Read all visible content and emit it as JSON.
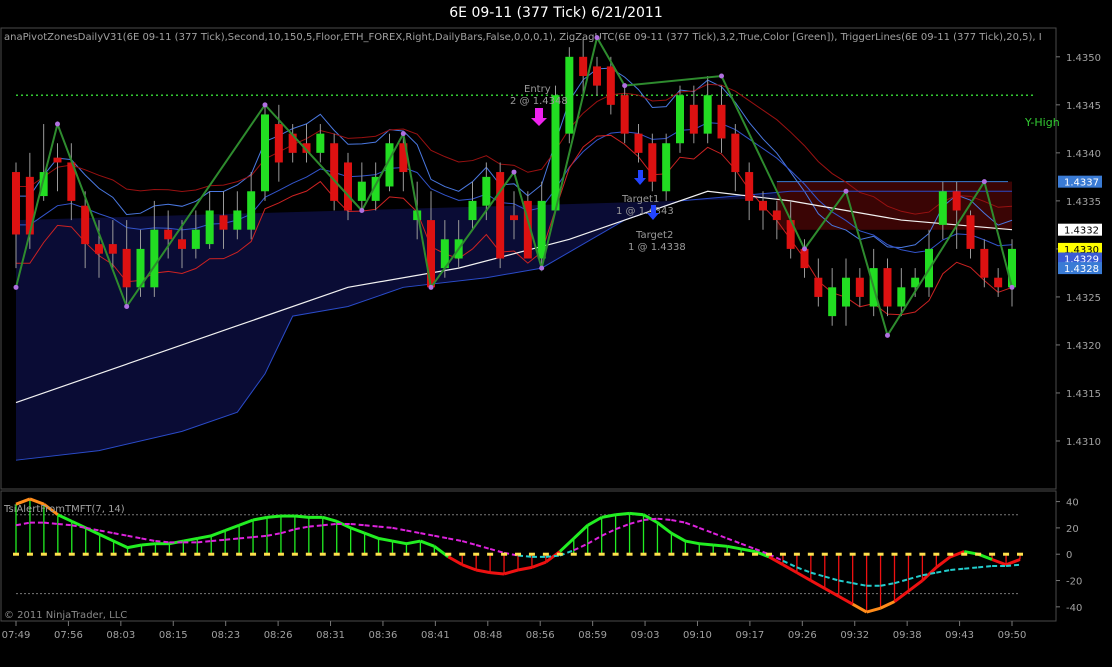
{
  "title": "6E 09-11 (377 Tick)  6/21/2011",
  "indicators_text": "anaPivotZonesDailyV31(6E 09-11 (377 Tick),Second,10,150,5,Floor,ETH_FOREX,Right,DailyBars,False,0,0,0,1), ZigZagUTC(6E 09-11 (377 Tick),3,2,True,Color [Green]), TriggerLines(6E 09-11 (377 Tick),20,5), I",
  "copyright": "© 2011 NinjaTrader, LLC",
  "colors": {
    "up_candle": "#22dd22",
    "down_candle": "#dd1111",
    "zigzag": "#2e8b2e",
    "pivot_dot": "#b070e0",
    "yhigh_line": "#33cc33",
    "upper_zone_fill": "#3a0505",
    "lower_zone_fill": "#0a0c35",
    "price_label_current": "#ffff00",
    "trigger_up": "#22ee22",
    "trigger_down": "#ee1111",
    "trigger_signal": "#dd22dd",
    "trigger_signal_2": "#22cccc"
  },
  "annotations": {
    "y_high": "Y-High",
    "entry": "Entry",
    "entry_detail": "2 @ 1.4348",
    "target1": "Target1",
    "target1_detail": "1 @ 1.4343",
    "target2": "Target2",
    "target2_detail": "1 @ 1.4338"
  },
  "chart_data": [
    {
      "type": "candlestick",
      "title": "6E 09-11 (377 Tick)  6/21/2011",
      "x_labels": [
        "07:49",
        "07:56",
        "08:03",
        "08:15",
        "08:23",
        "08:26",
        "08:31",
        "08:36",
        "08:41",
        "08:48",
        "08:56",
        "08:59",
        "09:03",
        "09:10",
        "09:17",
        "09:26",
        "09:32",
        "09:38",
        "09:43",
        "09:50"
      ],
      "ylim": [
        1.4305,
        1.4353
      ],
      "y_ticks": [
        "1.4350",
        "1.4345",
        "1.4340",
        "1.4335",
        "1.4330",
        "1.4325",
        "1.4320",
        "1.4315",
        "1.4310"
      ],
      "price_labels": [
        {
          "value": "1.4337",
          "color": "#3a7bd5"
        },
        {
          "value": "1.4332",
          "color": "#ffffff"
        },
        {
          "value": "1.4330",
          "color": "#ffff00"
        },
        {
          "value": "1.4329",
          "color": "#3a5bd5"
        },
        {
          "value": "1.4328",
          "color": "#3a7bd5"
        }
      ],
      "y_high": 1.4346,
      "candles": [
        [
          1.4338,
          1.43315,
          1.4339,
          1.4328
        ],
        [
          1.43375,
          1.43315,
          1.434,
          1.433
        ],
        [
          1.43355,
          1.4338,
          1.4343,
          1.4335
        ],
        [
          1.43395,
          1.4339,
          1.4341,
          1.4336
        ],
        [
          1.4339,
          1.4335,
          1.4341,
          1.4333
        ],
        [
          1.43345,
          1.43305,
          1.4336,
          1.4328
        ],
        [
          1.43305,
          1.43295,
          1.4333,
          1.4327
        ],
        [
          1.43305,
          1.43295,
          1.4333,
          1.4328
        ],
        [
          1.433,
          1.4326,
          1.4333,
          1.4324
        ],
        [
          1.4326,
          1.433,
          1.4332,
          1.4325
        ],
        [
          1.4326,
          1.4332,
          1.4335,
          1.4325
        ],
        [
          1.4332,
          1.4331,
          1.4334,
          1.4329
        ],
        [
          1.4331,
          1.433,
          1.4333,
          1.4328
        ],
        [
          1.433,
          1.4332,
          1.4334,
          1.4329
        ],
        [
          1.43305,
          1.4334,
          1.4336,
          1.433
        ],
        [
          1.43335,
          1.4332,
          1.4336,
          1.433
        ],
        [
          1.4332,
          1.4334,
          1.4336,
          1.4331
        ],
        [
          1.4332,
          1.4336,
          1.4338,
          1.4331
        ],
        [
          1.4336,
          1.4344,
          1.4345,
          1.4335
        ],
        [
          1.4343,
          1.4339,
          1.4345,
          1.4337
        ],
        [
          1.4342,
          1.434,
          1.4343,
          1.4339
        ],
        [
          1.4341,
          1.434,
          1.4343,
          1.4339
        ],
        [
          1.434,
          1.4342,
          1.4343,
          1.4339
        ],
        [
          1.4341,
          1.4335,
          1.4342,
          1.4334
        ],
        [
          1.4339,
          1.4334,
          1.434,
          1.4333
        ],
        [
          1.4335,
          1.4337,
          1.4339,
          1.4334
        ],
        [
          1.4335,
          1.43375,
          1.4339,
          1.4334
        ],
        [
          1.43365,
          1.4341,
          1.4342,
          1.4336
        ],
        [
          1.4341,
          1.4338,
          1.4342,
          1.4336
        ],
        [
          1.4333,
          1.4334,
          1.4337,
          1.4331
        ],
        [
          1.4333,
          1.4326,
          1.4336,
          1.4326
        ],
        [
          1.4328,
          1.4331,
          1.4333,
          1.4327
        ],
        [
          1.4329,
          1.4331,
          1.4333,
          1.4328
        ],
        [
          1.4333,
          1.4335,
          1.4337,
          1.4332
        ],
        [
          1.43345,
          1.43375,
          1.4339,
          1.4333
        ],
        [
          1.4338,
          1.4329,
          1.4339,
          1.4328
        ],
        [
          1.43335,
          1.4333,
          1.4336,
          1.4331
        ],
        [
          1.4335,
          1.4329,
          1.4336,
          1.4329
        ],
        [
          1.4329,
          1.4335,
          1.4337,
          1.4328
        ],
        [
          1.4334,
          1.4346,
          1.4347,
          1.4334
        ],
        [
          1.4342,
          1.435,
          1.4351,
          1.4341
        ],
        [
          1.435,
          1.4348,
          1.4352,
          1.4346
        ],
        [
          1.4349,
          1.4347,
          1.435,
          1.4346
        ],
        [
          1.4349,
          1.4345,
          1.435,
          1.4344
        ],
        [
          1.4346,
          1.4342,
          1.4347,
          1.4341
        ],
        [
          1.4342,
          1.434,
          1.4343,
          1.4339
        ],
        [
          1.4341,
          1.4337,
          1.4342,
          1.4336
        ],
        [
          1.4336,
          1.4341,
          1.4342,
          1.4335
        ],
        [
          1.4341,
          1.4346,
          1.4347,
          1.434
        ],
        [
          1.4345,
          1.4342,
          1.4347,
          1.4341
        ],
        [
          1.4342,
          1.4346,
          1.4348,
          1.4341
        ],
        [
          1.4345,
          1.43415,
          1.4347,
          1.434
        ],
        [
          1.4342,
          1.4338,
          1.4343,
          1.4336
        ],
        [
          1.4338,
          1.4335,
          1.4339,
          1.4333
        ],
        [
          1.4335,
          1.4334,
          1.4336,
          1.4332
        ],
        [
          1.4334,
          1.4333,
          1.4335,
          1.4331
        ],
        [
          1.4333,
          1.433,
          1.4335,
          1.4329
        ],
        [
          1.433,
          1.4328,
          1.4331,
          1.4327
        ],
        [
          1.4327,
          1.4325,
          1.4329,
          1.4324
        ],
        [
          1.4323,
          1.4326,
          1.4328,
          1.4322
        ],
        [
          1.4324,
          1.4327,
          1.4329,
          1.4322
        ],
        [
          1.4327,
          1.4325,
          1.4328,
          1.4324
        ],
        [
          1.4324,
          1.4328,
          1.433,
          1.4323
        ],
        [
          1.4328,
          1.4324,
          1.4329,
          1.4323
        ],
        [
          1.4324,
          1.4326,
          1.4328,
          1.4323
        ],
        [
          1.4326,
          1.4327,
          1.4328,
          1.4325
        ],
        [
          1.4326,
          1.433,
          1.4332,
          1.4325
        ],
        [
          1.43325,
          1.4336,
          1.4337,
          1.4331
        ],
        [
          1.4336,
          1.4334,
          1.4337,
          1.433
        ],
        [
          1.43335,
          1.433,
          1.4334,
          1.4329
        ],
        [
          1.433,
          1.4327,
          1.4331,
          1.4326
        ],
        [
          1.4327,
          1.4326,
          1.4328,
          1.4325
        ],
        [
          1.4326,
          1.433,
          1.4331,
          1.4324
        ]
      ],
      "zigzag": [
        [
          0,
          1.4326
        ],
        [
          3,
          1.4343
        ],
        [
          8,
          1.4324
        ],
        [
          18,
          1.4345
        ],
        [
          25,
          1.4334
        ],
        [
          28,
          1.4342
        ],
        [
          30,
          1.4326
        ],
        [
          36,
          1.4338
        ],
        [
          38,
          1.4328
        ],
        [
          42,
          1.4352
        ],
        [
          44,
          1.4347
        ],
        [
          51,
          1.4348
        ],
        [
          57,
          1.433
        ],
        [
          60,
          1.4336
        ],
        [
          63,
          1.4321
        ],
        [
          70,
          1.4337
        ],
        [
          72,
          1.4326
        ]
      ],
      "lower_band": [
        [
          0,
          1.4308
        ],
        [
          6,
          1.4309
        ],
        [
          12,
          1.4311
        ],
        [
          16,
          1.4313
        ],
        [
          18,
          1.4317
        ],
        [
          20,
          1.4323
        ],
        [
          24,
          1.4324
        ],
        [
          28,
          1.4326
        ],
        [
          34,
          1.4327
        ],
        [
          38,
          1.4328
        ],
        [
          44,
          1.4333
        ],
        [
          48,
          1.4335
        ],
        [
          56,
          1.4336
        ],
        [
          72,
          1.4336
        ]
      ],
      "upper_zone": [
        [
          55,
          1.4337
        ],
        [
          72,
          1.4337
        ],
        [
          72,
          1.4332
        ],
        [
          55,
          1.4332
        ]
      ],
      "white_line": [
        [
          0,
          1.4314
        ],
        [
          8,
          1.4318
        ],
        [
          16,
          1.4322
        ],
        [
          24,
          1.4326
        ],
        [
          32,
          1.4328
        ],
        [
          40,
          1.4331
        ],
        [
          46,
          1.4334
        ],
        [
          50,
          1.4336
        ],
        [
          56,
          1.4335
        ],
        [
          64,
          1.4333
        ],
        [
          72,
          1.4332
        ]
      ]
    },
    {
      "type": "line",
      "title": "TsiAlertFromTMFT(7, 14)",
      "ylim": [
        -50,
        45
      ],
      "y_ticks": [
        "40",
        "20",
        "0",
        "-20",
        "-40"
      ],
      "reference_lines": [
        30,
        0,
        -30
      ],
      "main": [
        38,
        42,
        38,
        30,
        25,
        20,
        15,
        10,
        5,
        7,
        8,
        8,
        10,
        12,
        14,
        18,
        22,
        26,
        28,
        29,
        29,
        28,
        28,
        25,
        20,
        16,
        12,
        10,
        8,
        10,
        6,
        -2,
        -8,
        -12,
        -14,
        -15,
        -12,
        -10,
        -6,
        2,
        12,
        22,
        28,
        30,
        31,
        30,
        24,
        16,
        10,
        8,
        7,
        6,
        4,
        2,
        -2,
        -8,
        -14,
        -20,
        -26,
        -32,
        -38,
        -44,
        -41,
        -36,
        -28,
        -20,
        -10,
        -2,
        2,
        0,
        -4,
        -8,
        -4
      ],
      "signal": [
        22,
        24,
        24,
        23,
        22,
        20,
        18,
        16,
        14,
        12,
        10,
        9,
        9,
        9,
        10,
        11,
        12,
        13,
        14,
        16,
        19,
        21,
        22,
        23,
        23,
        22,
        21,
        20,
        18,
        16,
        14,
        12,
        10,
        7,
        4,
        1,
        -1,
        -2,
        -2,
        -1,
        3,
        8,
        14,
        19,
        23,
        26,
        27,
        26,
        24,
        20,
        16,
        12,
        8,
        4,
        0,
        -5,
        -10,
        -14,
        -17,
        -20,
        -22,
        -24,
        -24,
        -22,
        -19,
        -16,
        -14,
        -12,
        -11,
        -10,
        -9,
        -9,
        -8
      ]
    }
  ]
}
